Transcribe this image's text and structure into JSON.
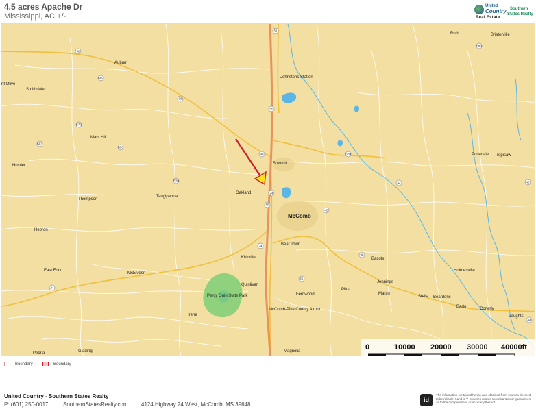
{
  "header": {
    "title": "4.5 acres Apache Dr",
    "subtitle": "Mississippi,  AC +/-"
  },
  "logo": {
    "line1": "United",
    "line2": "Country",
    "line3": "Real Estate",
    "brand1": "Southern",
    "brand2": "States Realty"
  },
  "colors": {
    "map_background": "#f3dfa1",
    "interstate": "#e8935a",
    "highway": "#f0bf3c",
    "water": "#5bb6e6",
    "park": "#7ccf75",
    "arrow_outline": "#d0202a",
    "arrow_fill": "#f7e21a"
  },
  "map": {
    "places": [
      {
        "name": "Ruth"
      },
      {
        "name": "Bristerville"
      },
      {
        "name": "Auburn"
      },
      {
        "name": "Johnstons Station"
      },
      {
        "name": "nt Olive"
      },
      {
        "name": "Smithdale"
      },
      {
        "name": "Mars Hill"
      },
      {
        "name": "Pricedale"
      },
      {
        "name": "Topisaw"
      },
      {
        "name": "Hustler"
      },
      {
        "name": "Summit"
      },
      {
        "name": "Tangipahoa"
      },
      {
        "name": "Oakland"
      },
      {
        "name": "Thompson"
      },
      {
        "name": "McComb"
      },
      {
        "name": "Hebron"
      },
      {
        "name": "Bear Town"
      },
      {
        "name": "Kirkville"
      },
      {
        "name": "Bacots"
      },
      {
        "name": "East Fork"
      },
      {
        "name": "McElveen"
      },
      {
        "name": "Holmesville"
      },
      {
        "name": "Quinlivan"
      },
      {
        "name": "Jennings"
      },
      {
        "name": "Pitts"
      },
      {
        "name": "Martin"
      },
      {
        "name": "Fernwood"
      },
      {
        "name": "Stella"
      },
      {
        "name": "Beardens"
      },
      {
        "name": "Barto"
      },
      {
        "name": "Conerly"
      },
      {
        "name": "Irene"
      },
      {
        "name": "Vaughts"
      },
      {
        "name": "McComb-Pike County Airport"
      },
      {
        "name": "Percy Quin State Park"
      },
      {
        "name": "Glading"
      },
      {
        "name": "Peoria"
      },
      {
        "name": "Magnolia"
      }
    ],
    "route_shields": [
      "51",
      "98",
      "583",
      "569",
      "98",
      "55",
      "570",
      "583",
      "570",
      "98",
      "570",
      "570",
      "24",
      "24",
      "98",
      "51",
      "55",
      "44",
      "48",
      "48",
      "24",
      "44"
    ],
    "scale_ticks": [
      "0",
      "10000",
      "20000",
      "30000",
      "40000ft"
    ]
  },
  "legend": [
    {
      "label": "Boundary"
    },
    {
      "label": "Boundary"
    }
  ],
  "footer": {
    "company": "United Country - Southern States Realty",
    "phone": "P: (601) 250-0017",
    "website": "SouthernStatesRealty.com",
    "address": "4124 Highway 24 West, McComb, MS 39648",
    "badge": "id",
    "disclaimer": "The information contained herein was obtained from sources deemed to be reliable. Land id™ Services makes no warranties or guarantees as to the completeness or accuracy thereof."
  }
}
